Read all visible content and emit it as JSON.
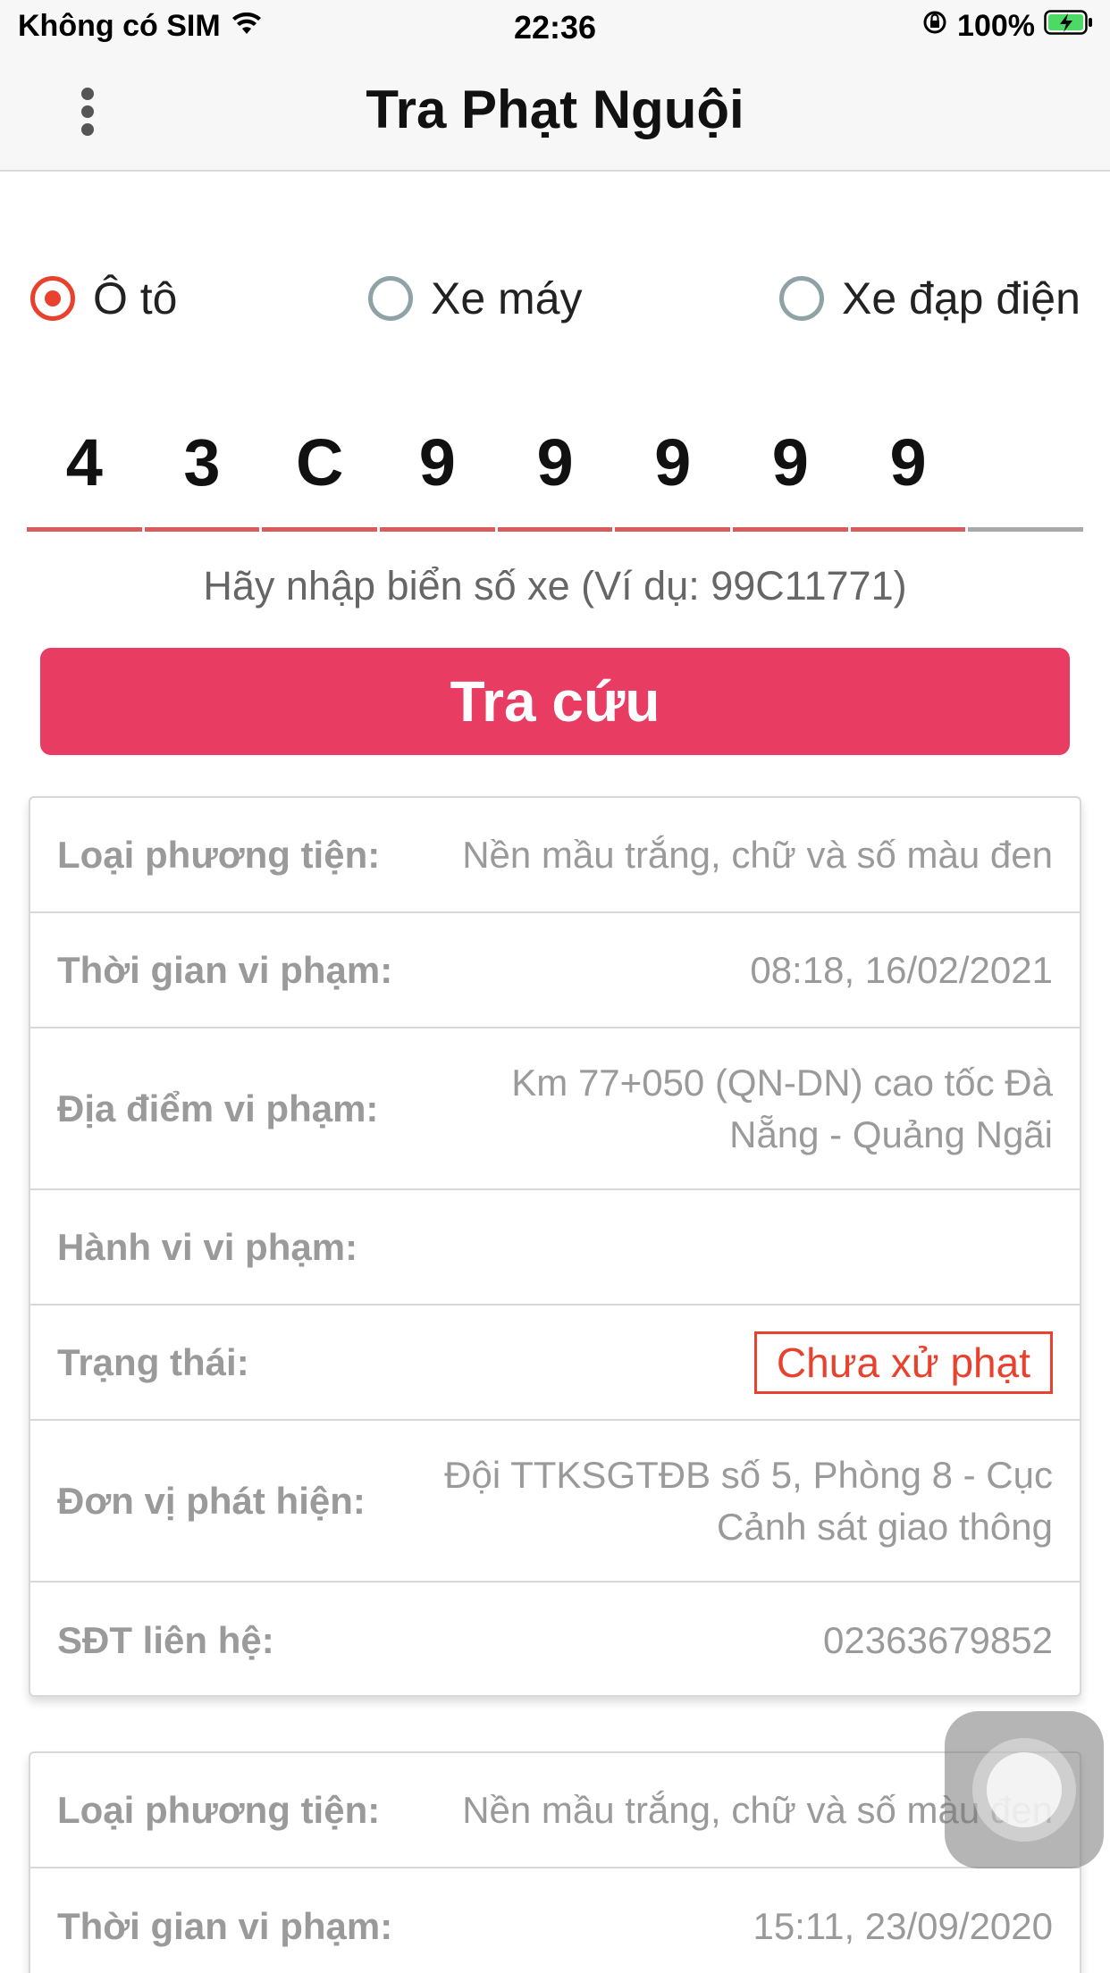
{
  "status_bar": {
    "carrier": "Không có SIM",
    "time": "22:36",
    "battery": "100%",
    "wifi_icon": "wifi-icon",
    "lock_icon": "rotation-lock-icon",
    "battery_icon": "battery-charging-icon"
  },
  "nav": {
    "title": "Tra Phạt Nguội",
    "menu_icon": "more-vertical-icon"
  },
  "vehicle_types": [
    {
      "label": "Ô tô",
      "selected": true
    },
    {
      "label": "Xe máy",
      "selected": false
    },
    {
      "label": "Xe đạp điện",
      "selected": false
    }
  ],
  "plate": {
    "chars": [
      "4",
      "3",
      "C",
      "9",
      "9",
      "9",
      "9",
      "9",
      ""
    ],
    "hint": "Hãy nhập biển số xe (Ví dụ: 99C11771)"
  },
  "search_button": "Tra cứu",
  "results": [
    {
      "loai_label": "Loại phương tiện:",
      "loai_value": "Nền mầu trắng, chữ và số màu đen",
      "thoigian_label": "Thời gian vi phạm:",
      "thoigian_value": "08:18, 16/02/2021",
      "diadiem_label": "Địa điểm vi phạm:",
      "diadiem_value": "Km 77+050 (QN-DN) cao tốc Đà Nẵng - Quảng Ngãi",
      "hanhvi_label": "Hành vi vi phạm:",
      "hanhvi_value": "",
      "trangthai_label": "Trạng thái:",
      "trangthai_value": "Chưa xử phạt",
      "donvi_label": "Đơn vị phát hiện:",
      "donvi_value": "Đội TTKSGTĐB số 5, Phòng 8 - Cục Cảnh sát giao thông",
      "sdt_label": "SĐT liên hệ:",
      "sdt_value": "02363679852"
    },
    {
      "loai_label": "Loại phương tiện:",
      "loai_value": "Nền mầu trắng, chữ và số màu đen",
      "thoigian_label": "Thời gian vi phạm:",
      "thoigian_value": "15:11, 23/09/2020"
    }
  ],
  "colors": {
    "accent": "#e93c63",
    "radio_selected": "#e8412e",
    "status_red": "#e8412e"
  }
}
